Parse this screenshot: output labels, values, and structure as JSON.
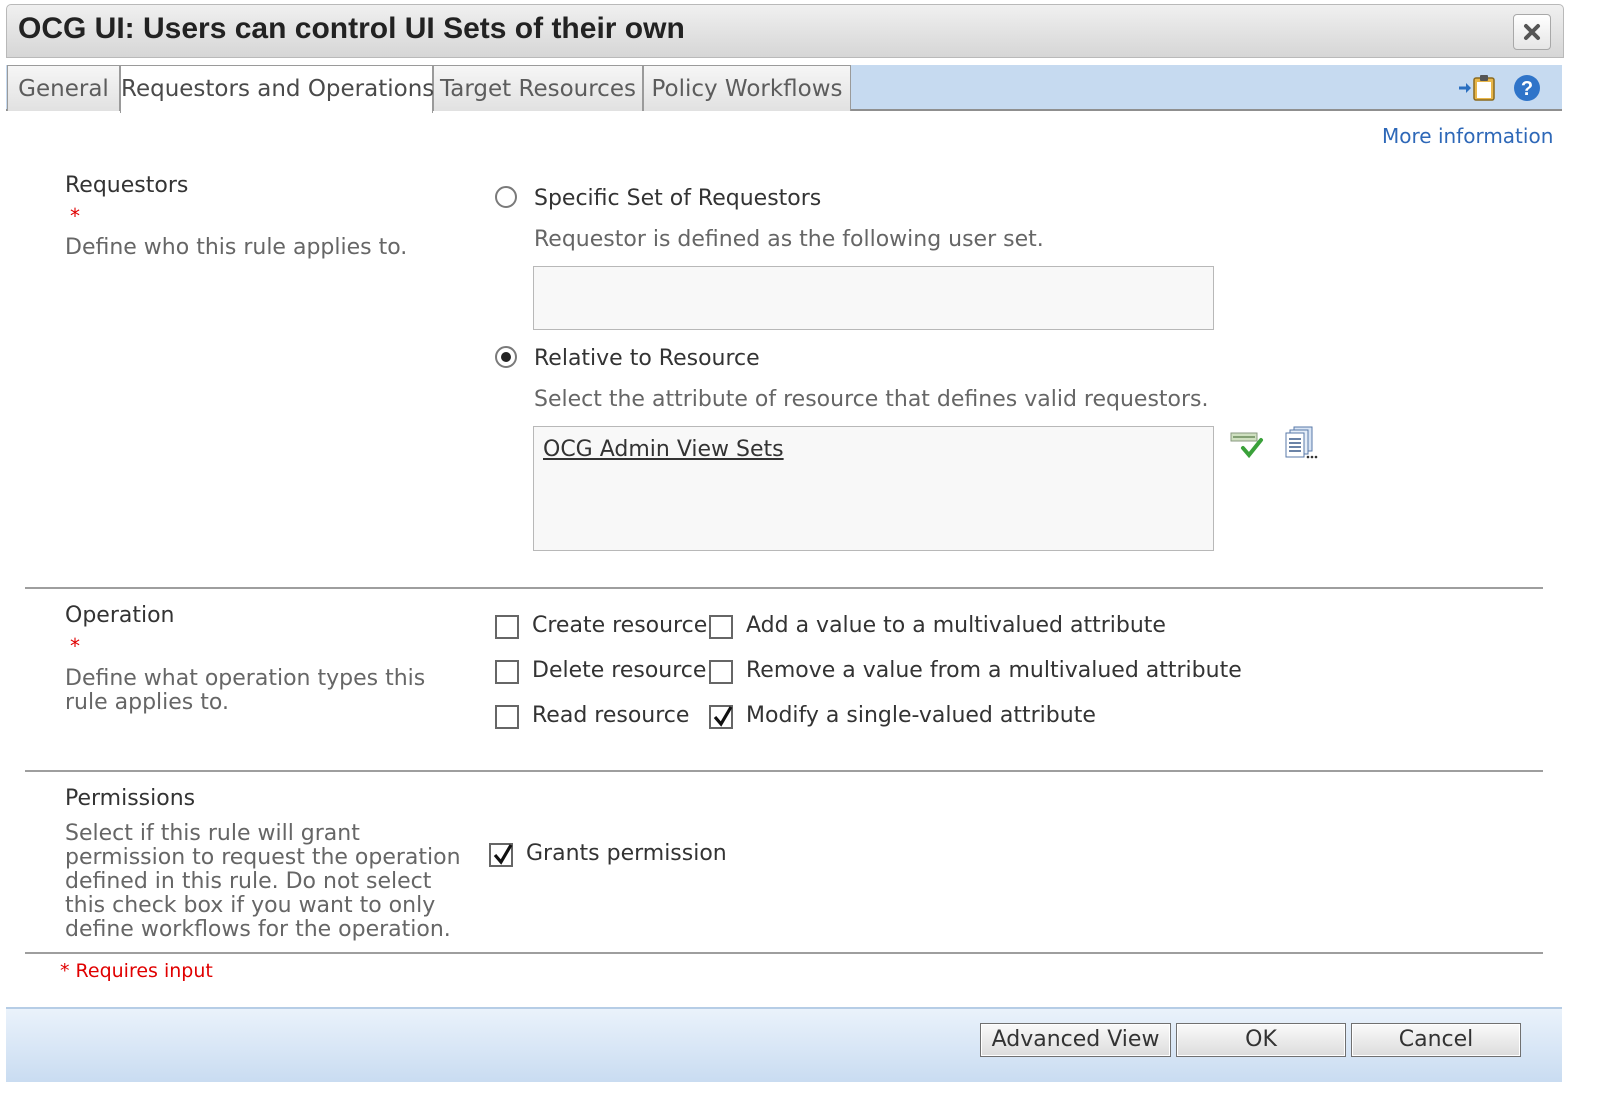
{
  "window": {
    "title": "OCG UI: Users can control UI Sets of their own"
  },
  "tabs": [
    {
      "label": "General"
    },
    {
      "label": "Requestors and Operations"
    },
    {
      "label": "Target Resources"
    },
    {
      "label": "Policy Workflows"
    }
  ],
  "active_tab": "Requestors and Operations",
  "more_info": "More information",
  "requestors": {
    "label": "Requestors",
    "required_mark": "*",
    "description": "Define who this rule applies to.",
    "options": [
      {
        "label": "Specific Set of Requestors",
        "help": "Requestor is defined as the following user set.",
        "selected": false,
        "value": ""
      },
      {
        "label": "Relative to Resource",
        "help": "Select the attribute of resource that defines valid requestors.",
        "selected": true,
        "value": "OCG Admin View Sets"
      }
    ]
  },
  "operation": {
    "label": "Operation",
    "required_mark": "*",
    "description": "Define what operation types this rule applies to.",
    "checkboxes": [
      {
        "label": "Create resource",
        "checked": false
      },
      {
        "label": "Add a value to a multivalued attribute",
        "checked": false
      },
      {
        "label": "Delete resource",
        "checked": false
      },
      {
        "label": "Remove a value from a multivalued attribute",
        "checked": false
      },
      {
        "label": "Read resource",
        "checked": false
      },
      {
        "label": "Modify a single-valued attribute",
        "checked": true
      }
    ]
  },
  "permissions": {
    "label": "Permissions",
    "description": "Select if this rule will grant permission to request the operation defined in this rule. Do not select this check box if you want to only define workflows for the operation.",
    "grants_label": "Grants permission",
    "grants_checked": true
  },
  "requires_input": "* Requires input",
  "buttons": {
    "advanced": "Advanced View",
    "ok": "OK",
    "cancel": "Cancel"
  },
  "icons": [
    "close-icon",
    "export-clipboard-icon",
    "help-icon",
    "validate-check-icon",
    "browse-list-icon"
  ]
}
